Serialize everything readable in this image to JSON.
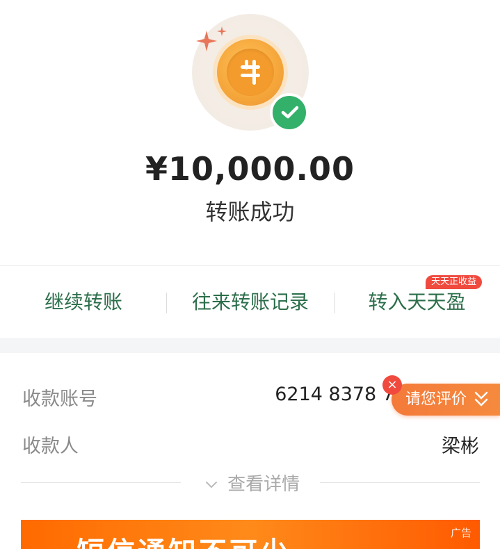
{
  "result": {
    "amount": "¥10,000.00",
    "status": "转账成功"
  },
  "actions": {
    "continue_transfer": "继续转账",
    "transfer_records": "往来转账记录",
    "to_wealth": "转入天天盈",
    "promo_badge": "天天正收益"
  },
  "details": {
    "account_label": "收款账号",
    "account_value": "6214 8378 7",
    "payee_label": "收款人",
    "payee_value": "梁彬",
    "view_more": "查看详情"
  },
  "rating": {
    "label": "请您评价",
    "close": "×"
  },
  "ad": {
    "tag": "广告",
    "text": "短信通知不可少"
  },
  "colors": {
    "action_green": "#2c6e4a",
    "success_green": "#33b06a",
    "coin_orange": "#f5a63a",
    "rating_orange": "#f47a3a",
    "promo_red": "#f04a3f"
  },
  "icons": [
    "sparkle-icon",
    "coin-icon",
    "check-icon",
    "chevron-down-icon",
    "close-icon"
  ]
}
